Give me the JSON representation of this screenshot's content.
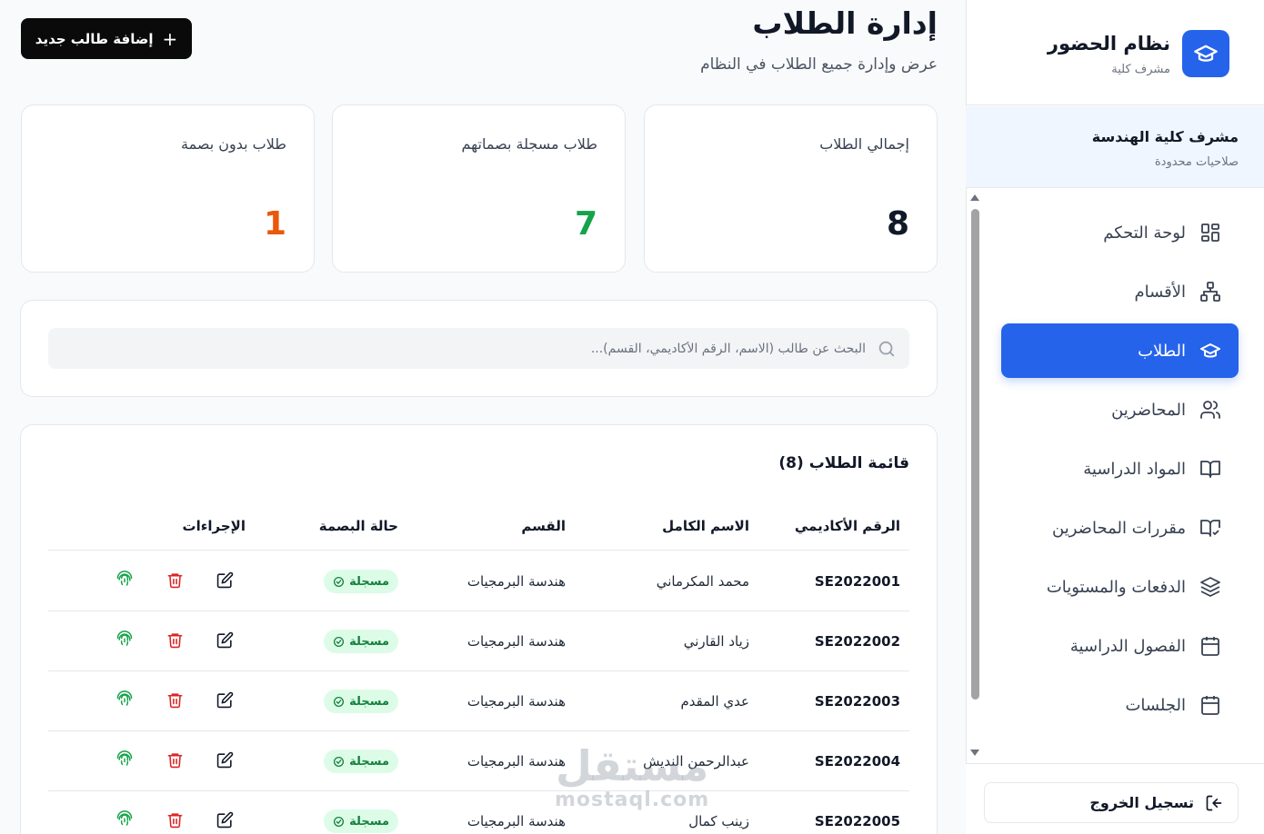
{
  "sidebar": {
    "brand_title": "نظام الحضور",
    "brand_sub": "مشرف كلية",
    "role_title": "مشرف كلية الهندسة",
    "role_sub": "صلاحيات محدودة",
    "items": [
      {
        "label": "لوحة التحكم",
        "icon": "dashboard-icon"
      },
      {
        "label": "الأقسام",
        "icon": "sitemap-icon"
      },
      {
        "label": "الطلاب",
        "icon": "graduation-cap-icon",
        "active": true
      },
      {
        "label": "المحاضرين",
        "icon": "users-icon"
      },
      {
        "label": "المواد الدراسية",
        "icon": "book-open-icon"
      },
      {
        "label": "مقررات المحاضرين",
        "icon": "book-check-icon"
      },
      {
        "label": "الدفعات والمستويات",
        "icon": "layers-icon"
      },
      {
        "label": "الفصول الدراسية",
        "icon": "calendar-grid-icon"
      },
      {
        "label": "الجلسات",
        "icon": "calendar-icon"
      }
    ],
    "logout_label": "تسجيل الخروج"
  },
  "header": {
    "title": "إدارة الطلاب",
    "subtitle": "عرض وإدارة جميع الطلاب في النظام",
    "add_button": "إضافة طالب جديد"
  },
  "stats": [
    {
      "label": "إجمالي الطلاب",
      "value": "8",
      "color": "#111827"
    },
    {
      "label": "طلاب مسجلة بصماتهم",
      "value": "7",
      "color": "#16a34a"
    },
    {
      "label": "طلاب بدون بصمة",
      "value": "1",
      "color": "#ea580c"
    }
  ],
  "search": {
    "placeholder": "البحث عن طالب (الاسم، الرقم الأكاديمي، القسم)..."
  },
  "table": {
    "title": "قائمة الطلاب (8)",
    "headers": {
      "id": "الرقم الأكاديمي",
      "name": "الاسم الكامل",
      "dept": "القسم",
      "status": "حالة البصمة",
      "actions": "الإجراءات"
    },
    "rows": [
      {
        "id": "SE2022001",
        "name": "محمد المكرماني",
        "dept": "هندسة البرمجيات",
        "status": "مسجلة"
      },
      {
        "id": "SE2022002",
        "name": "زياد القارني",
        "dept": "هندسة البرمجيات",
        "status": "مسجلة"
      },
      {
        "id": "SE2022003",
        "name": "عدي المقدم",
        "dept": "هندسة البرمجيات",
        "status": "مسجلة"
      },
      {
        "id": "SE2022004",
        "name": "عبدالرحمن النديش",
        "dept": "هندسة البرمجيات",
        "status": "مسجلة"
      },
      {
        "id": "SE2022005",
        "name": "زينب كمال",
        "dept": "هندسة البرمجيات",
        "status": "مسجلة"
      }
    ]
  },
  "watermark": {
    "line1": "مستقل",
    "line2": "mostaql.com"
  },
  "colors": {
    "accent": "#2563eb",
    "success": "#16a34a",
    "danger": "#dc2626",
    "warning": "#ea580c"
  }
}
